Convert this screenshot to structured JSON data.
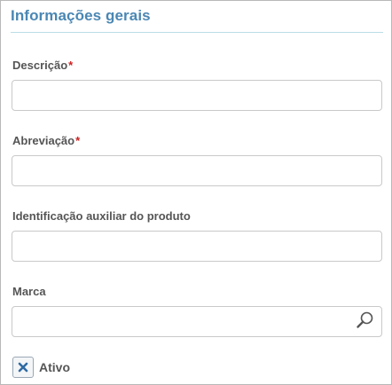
{
  "section": {
    "title": "Informações gerais"
  },
  "fields": {
    "descricao": {
      "label": "Descrição",
      "required_mark": "*",
      "value": ""
    },
    "abreviacao": {
      "label": "Abreviação",
      "required_mark": "*",
      "value": ""
    },
    "identificacao": {
      "label": "Identificação auxiliar do produto",
      "value": ""
    },
    "marca": {
      "label": "Marca",
      "value": "",
      "search_icon": "search-icon"
    }
  },
  "ativo": {
    "label": "Ativo",
    "checked": true,
    "icon": "x-check-icon"
  },
  "colors": {
    "title": "#4a87b4",
    "title_rule": "#b9dde6",
    "required": "#cc2222",
    "label": "#555555",
    "checkbox_mark": "#2f6aa3"
  }
}
